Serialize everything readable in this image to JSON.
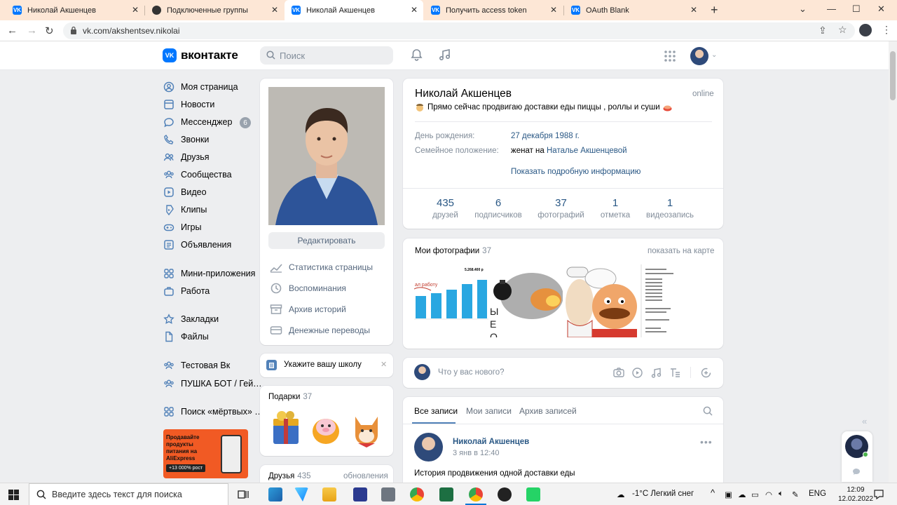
{
  "browser": {
    "tabs": [
      {
        "title": "Николай Акшенцев",
        "active": false
      },
      {
        "title": "Подключенные группы",
        "active": false
      },
      {
        "title": "Николай Акшенцев",
        "active": true
      },
      {
        "title": "Получить access token",
        "active": false
      },
      {
        "title": "OAuth Blank",
        "active": false
      }
    ],
    "url": "vk.com/akshentsev.nikolai"
  },
  "vk": {
    "logo": "вконтакте",
    "logo_badge": "VK",
    "search_placeholder": "Поиск"
  },
  "sidebar": {
    "items": [
      {
        "label": "Моя страница",
        "icon": "user-circle-icon"
      },
      {
        "label": "Новости",
        "icon": "newspaper-icon"
      },
      {
        "label": "Мессенджер",
        "icon": "chat-bubble-icon"
      },
      {
        "label": "Звонки",
        "icon": "phone-icon"
      },
      {
        "label": "Друзья",
        "icon": "friends-icon"
      },
      {
        "label": "Сообщества",
        "icon": "communities-icon"
      },
      {
        "label": "Видео",
        "icon": "video-icon"
      },
      {
        "label": "Клипы",
        "icon": "clips-icon"
      },
      {
        "label": "Игры",
        "icon": "gamepad-icon"
      },
      {
        "label": "Объявления",
        "icon": "ads-icon"
      },
      {
        "label": "Мини-приложения",
        "icon": "apps-icon"
      },
      {
        "label": "Работа",
        "icon": "briefcase-icon"
      },
      {
        "label": "Закладки",
        "icon": "star-icon"
      },
      {
        "label": "Файлы",
        "icon": "file-icon"
      },
      {
        "label": "Тестовая Вк",
        "icon": "communities-icon"
      },
      {
        "label": "ПУШКА БОТ / Гей…",
        "icon": "communities-icon"
      },
      {
        "label": "Поиск «мёртвых» …",
        "icon": "apps-icon"
      }
    ],
    "messenger_badge": "6",
    "promo": {
      "text": "Продавайте продукты питания на AliExpress",
      "badge": "+13 000% рост"
    }
  },
  "profile_left": {
    "edit_button": "Редактировать",
    "links": [
      {
        "label": "Статистика страницы",
        "icon": "chart-icon"
      },
      {
        "label": "Воспоминания",
        "icon": "history-icon"
      },
      {
        "label": "Архив историй",
        "icon": "archive-icon"
      },
      {
        "label": "Денежные переводы",
        "icon": "money-transfer-icon"
      }
    ],
    "school_prompt": "Укажите вашу школу",
    "gifts": {
      "title": "Подарки",
      "count": "37"
    },
    "friends": {
      "title": "Друзья",
      "count": "435",
      "updates": "обновления"
    }
  },
  "profile": {
    "name": "Николай Акшенцев",
    "online": "online",
    "status": "Прямо сейчас продвигаю доставки еды пиццы , роллы и суши",
    "birthday_label": "День рождения:",
    "birthday": "27 декабря 1988 г.",
    "family_label": "Семейное положение:",
    "family_prefix": "женат на",
    "family_spouse": "Наталье Акшенцевой",
    "more_info": "Показать подробную информацию",
    "counters": [
      {
        "value": "435",
        "label": "друзей"
      },
      {
        "value": "6",
        "label": "подписчиков"
      },
      {
        "value": "37",
        "label": "фотографий"
      },
      {
        "value": "1",
        "label": "отметка"
      },
      {
        "value": "1",
        "label": "видеозапись"
      }
    ]
  },
  "photos": {
    "title": "Мои фотографии",
    "count": "37",
    "map_link": "показать на карте",
    "chart_caption": "5.268.400 р",
    "chart_label": "ал работу",
    "overlay_text": "ЫЕ ОВ"
  },
  "composer": {
    "placeholder": "Что у вас нового?"
  },
  "wall": {
    "tabs": [
      "Все записи",
      "Мои записи",
      "Архив записей"
    ],
    "post": {
      "author": "Николай Акшенцев",
      "date": "3 янв в 12:40",
      "text": "История продвижения одной доставки еды"
    }
  },
  "taskbar": {
    "search_placeholder": "Введите здесь текст для поиска",
    "weather": "-1°C  Легкий снег",
    "lang": "ENG",
    "time": "12:09",
    "date": "12.02.2022"
  }
}
